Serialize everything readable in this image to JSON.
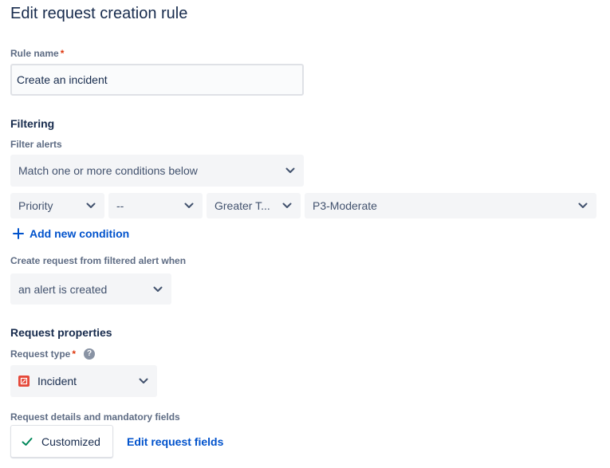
{
  "page": {
    "title": "Edit request creation rule"
  },
  "rule_name": {
    "label": "Rule name",
    "required_mark": "*",
    "value": "Create an incident"
  },
  "filtering": {
    "heading": "Filtering",
    "filter_alerts_label": "Filter alerts",
    "match_select": "Match one or more conditions below",
    "condition": {
      "field": "Priority",
      "modifier": "--",
      "operator": "Greater T...",
      "value": "P3-Moderate"
    },
    "add_condition_label": "Add new condition",
    "create_when_label": "Create request from filtered alert when",
    "create_when_value": "an alert is created"
  },
  "request_properties": {
    "heading": "Request properties",
    "request_type_label": "Request type",
    "required_mark": "*",
    "help_glyph": "?",
    "request_type_value": "Incident",
    "details_label": "Request details and mandatory fields",
    "customized_button": "Customized",
    "edit_fields_link": "Edit request fields"
  },
  "colors": {
    "link": "#0052cc",
    "required": "#de350b",
    "success": "#00875a",
    "incident_icon": "#e5493a"
  },
  "icons": [
    "chevron-down-icon",
    "plus-icon",
    "help-icon",
    "incident-icon",
    "check-icon"
  ]
}
